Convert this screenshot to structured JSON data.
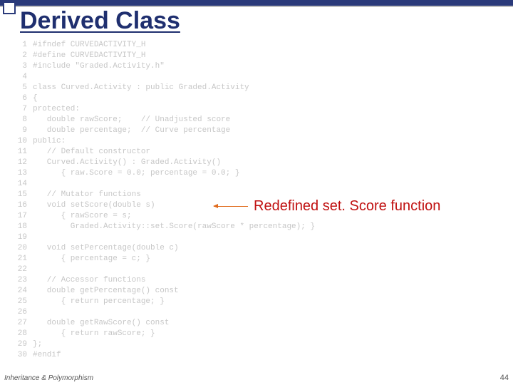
{
  "slide": {
    "title": "Derived Class",
    "footer_left": "Inheritance & Polymorphism",
    "page_number": "44"
  },
  "annotation": {
    "label": "Redefined set. Score function"
  },
  "code_lines": [
    "#ifndef CURVEDACTIVITY_H",
    "#define CURVEDACTIVITY_H",
    "#include \"Graded.Activity.h\"",
    "",
    "class Curved.Activity : public Graded.Activity",
    "{",
    "protected:",
    "   double rawScore;    // Unadjusted score",
    "   double percentage;  // Curve percentage",
    "public:",
    "   // Default constructor",
    "   Curved.Activity() : Graded.Activity()",
    "      { raw.Score = 0.0; percentage = 0.0; }",
    "",
    "   // Mutator functions",
    "   void setScore(double s)",
    "      { rawScore = s;",
    "        Graded.Activity::set.Score(rawScore * percentage); }",
    "",
    "   void setPercentage(double c)",
    "      { percentage = c; }",
    "",
    "   // Accessor functions",
    "   double getPercentage() const",
    "      { return percentage; }",
    "",
    "   double getRawScore() const",
    "      { return rawScore; }",
    "};",
    "#endif"
  ]
}
